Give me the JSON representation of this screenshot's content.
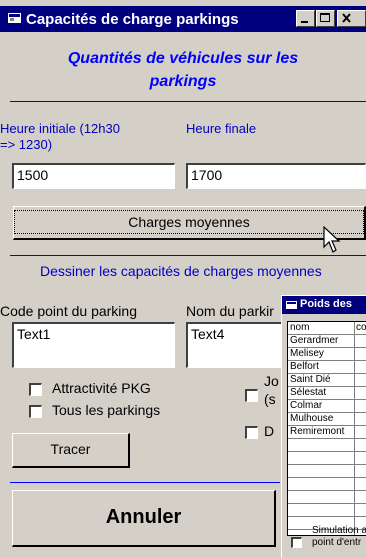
{
  "window": {
    "title": "Capacités de charge parkings"
  },
  "header": {
    "line1": "Quantités de véhicules sur les",
    "line2": "parkings"
  },
  "heure_initiale": {
    "label_line1": "Heure initiale (12h30",
    "label_line2": "=> 1230)",
    "value": "1500"
  },
  "heure_finale": {
    "label": "Heure finale",
    "value": "1700"
  },
  "charges_button": "Charges moyennes",
  "section_title": "Dessiner les capacités de charges moyennes",
  "code_point": {
    "label": "Code point du parking",
    "value": "Text1"
  },
  "nom_parking": {
    "label": "Nom du parkir",
    "value": "Text4"
  },
  "checkboxes": {
    "attractivite": "Attractivité PKG",
    "tous": "Tous les parkings",
    "jo_line1": "Jo",
    "jo_line2": "(s",
    "d": "D"
  },
  "tracer_button": "Tracer",
  "annuler_button": "Annuler",
  "subwindow": {
    "title": "Poids des",
    "columns": [
      "nom",
      "co"
    ],
    "rows": [
      "Gerardmer",
      "Melisey",
      "Belfort",
      "Saint Dié",
      "Sélestat",
      "Colmar",
      "Mulhouse",
      "Remiremont"
    ],
    "simulation_line1": "Simulation a",
    "simulation_line2": "point d'entr"
  },
  "colors": {
    "titlebar": "#00007f",
    "accent_text": "#0000ff",
    "window_bg": "#d4d0c8"
  }
}
